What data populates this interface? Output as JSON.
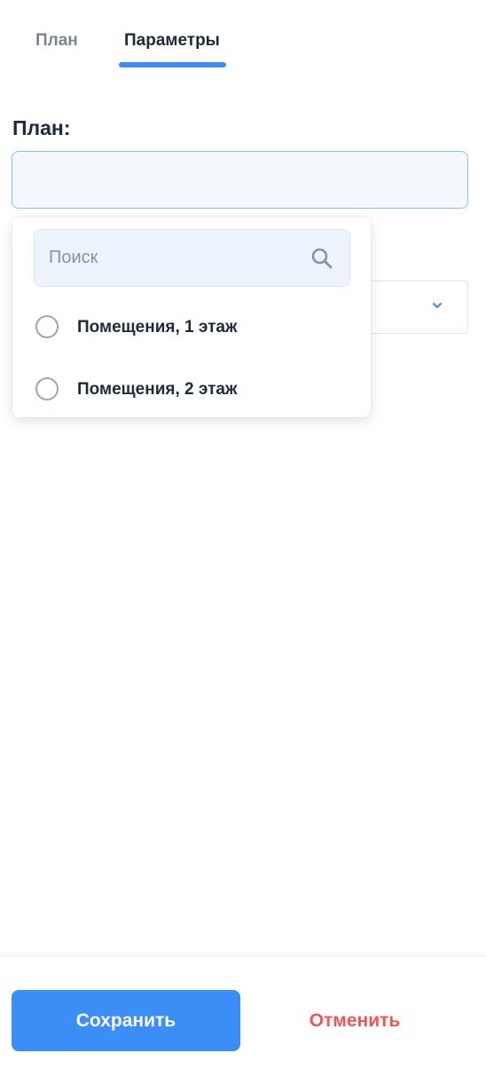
{
  "tabs": [
    {
      "label": "План",
      "active": false
    },
    {
      "label": "Параметры",
      "active": true
    }
  ],
  "plan_field": {
    "label": "План:",
    "value": ""
  },
  "dropdown": {
    "search_placeholder": "Поиск",
    "search_icon": "search-icon",
    "options": [
      {
        "label": "Помещения, 1 этаж",
        "selected": false
      },
      {
        "label": "Помещения, 2 этаж",
        "selected": false
      }
    ]
  },
  "footer": {
    "save_label": "Сохранить",
    "cancel_label": "Отменить"
  },
  "colors": {
    "accent": "#3a8ef6",
    "danger": "#f25555",
    "text": "#1e2a3a",
    "muted": "#7a8594"
  }
}
